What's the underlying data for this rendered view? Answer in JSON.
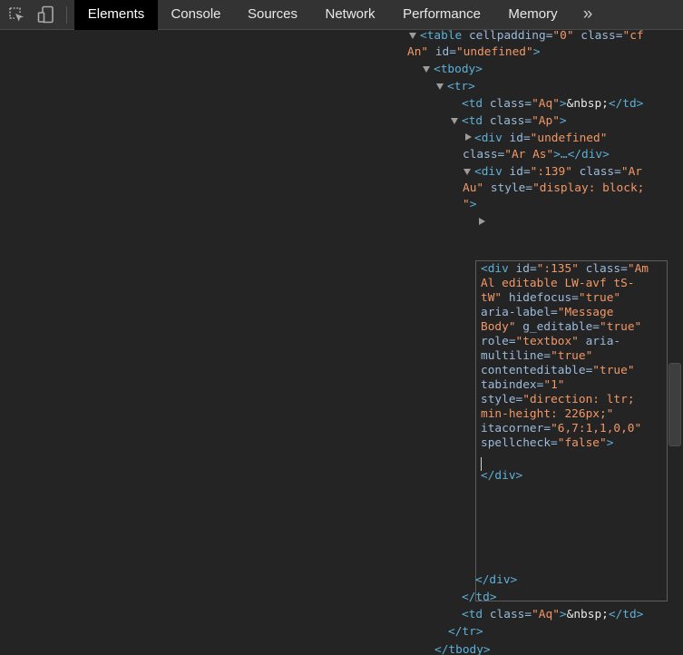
{
  "toolbar": {
    "tabs": [
      "Elements",
      "Console",
      "Sources",
      "Network",
      "Performance",
      "Memory"
    ],
    "more": "»"
  },
  "tree": {
    "l1a": "<table",
    "l1b": " cellpadding",
    "l1c": "=",
    "l1d": "\"0\"",
    "l1e": " class",
    "l1f": "=",
    "l1g": "\"cf",
    "l2a": "An\"",
    "l2b": " id",
    "l2c": "=",
    "l2d": "\"undefined\"",
    "l2e": ">",
    "tbody_open": "<tbody>",
    "tr_open": "<tr>",
    "td_aq1_a": "<td",
    "td_aq1_b": " class",
    "td_aq1_c": "=",
    "td_aq1_d": "\"Aq\"",
    "td_aq1_e": ">",
    "td_aq1_f": "&nbsp;",
    "td_aq1_g": "</td>",
    "td_ap_a": "<td",
    "td_ap_b": " class",
    "td_ap_c": "=",
    "td_ap_d": "\"Ap\"",
    "td_ap_e": ">",
    "div1_a": "<div",
    "div1_b": " id",
    "div1_c": "=",
    "div1_d": "\"undefined\"",
    "div1_e": "class",
    "div1_f": "=",
    "div1_g": "\"Ar As\"",
    "div1_h": ">…</div>",
    "div2_a": "<div",
    "div2_b": " id",
    "div2_c": "=",
    "div2_d": "\":139\"",
    "div2_e": " class",
    "div2_f": "=",
    "div2_g": "\"Ar",
    "div2_h": "Au\"",
    "div2_i": " style",
    "div2_j": "=",
    "div2_k": "\"display: block;",
    "div2_l": "\"",
    "div2_m": ">",
    "close_div": "</div>",
    "close_td": "</td>",
    "td_aq2_a": "<td",
    "td_aq2_b": " class",
    "td_aq2_c": "=",
    "td_aq2_d": "\"Aq\"",
    "td_aq2_e": ">",
    "td_aq2_f": "&nbsp;",
    "td_aq2_g": "</td>",
    "close_tr": "</tr>",
    "close_tbody": "</tbody>"
  },
  "editor": {
    "e1a": "<div",
    "e1b": " id",
    "e1c": "=",
    "e1d": "\":135\"",
    "e1e": " class",
    "e1f": "=",
    "e1g": "\"Am",
    "e2": "Al editable LW-avf tS-",
    "e3a": "tW\"",
    "e3b": " hidefocus",
    "e3c": "=",
    "e3d": "\"true\"",
    "e4a": "aria-label",
    "e4b": "=",
    "e4c": "\"Message",
    "e5a": "Body\"",
    "e5b": " g_editable",
    "e5c": "=",
    "e5d": "\"true\"",
    "e6a": "role",
    "e6b": "=",
    "e6c": "\"textbox\"",
    "e6d": " aria-",
    "e7a": "multiline",
    "e7b": "=",
    "e7c": "\"true\"",
    "e8a": "contenteditable",
    "e8b": "=",
    "e8c": "\"true\"",
    "e9a": "tabindex",
    "e9b": "=",
    "e9c": "\"1\"",
    "e10a": "style",
    "e10b": "=",
    "e10c": "\"direction: ltr;",
    "e11": "min-height: 226px;\"",
    "e12a": "itacorner",
    "e12b": "=",
    "e12c": "\"6,7:1,1,0,0\"",
    "e13a": "spellcheck",
    "e13b": "=",
    "e13c": "\"false\"",
    "e13d": ">",
    "close": "</div>"
  },
  "colors": {
    "tag": "#5db0d7",
    "attr_name": "#9bbbdc",
    "attr_value": "#f29766",
    "text": "#e8e8e8",
    "background": "#242424",
    "toolbar": "#333333",
    "active_tab": "#000000"
  }
}
